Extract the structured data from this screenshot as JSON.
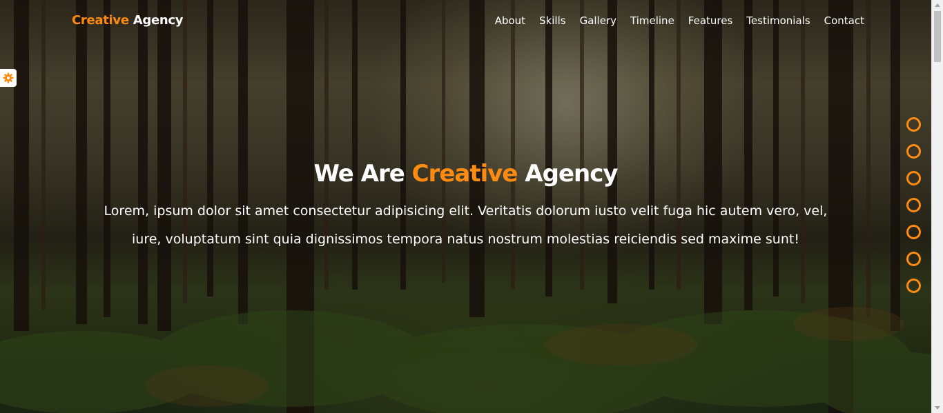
{
  "brand": {
    "name_accent": "Creative",
    "name_rest": " Agency"
  },
  "nav": {
    "items": [
      {
        "label": "About"
      },
      {
        "label": "Skills"
      },
      {
        "label": "Gallery"
      },
      {
        "label": "Timeline"
      },
      {
        "label": "Features"
      },
      {
        "label": "Testimonials"
      },
      {
        "label": "Contact"
      }
    ]
  },
  "hero": {
    "headline_pre": "We Are ",
    "headline_accent": "Creative",
    "headline_post": " Agency",
    "text": "Lorem, ipsum dolor sit amet consectetur adipisicing elit. Veritatis dolorum iusto velit fuga hic autem vero, vel, iure, voluptatum sint quia dignissimos tempora natus nostrum molestias reiciendis sed maxime sunt!"
  },
  "settings": {
    "icon": "gear-icon"
  },
  "bullets": {
    "count": 7
  },
  "colors": {
    "accent": "#ff8c10",
    "text": "#ffffff"
  }
}
